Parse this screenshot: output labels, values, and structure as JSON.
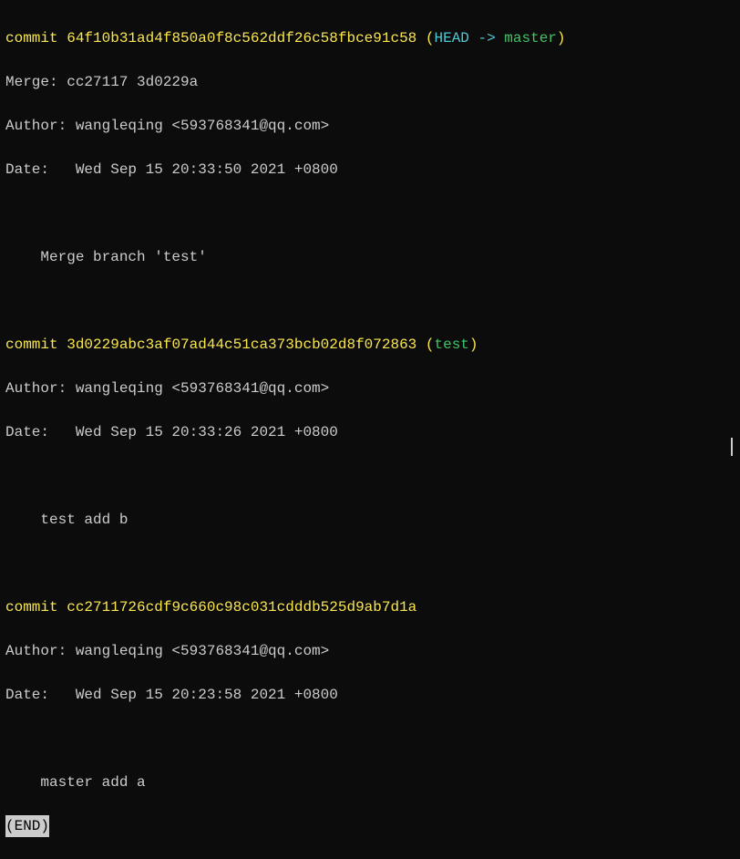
{
  "commits": [
    {
      "commit_label": "commit ",
      "hash": "64f10b31ad4f850a0f8c562ddf26c58fbce91c58",
      "ref_open": " (",
      "ref_head": "HEAD -> ",
      "ref_branch": "master",
      "ref_close": ")",
      "merge_line": "Merge: cc27117 3d0229a",
      "author_line": "Author: wangleqing <593768341@qq.com>",
      "date_line": "Date:   Wed Sep 15 20:33:50 2021 +0800",
      "message": "    Merge branch 'test'"
    },
    {
      "commit_label": "commit ",
      "hash": "3d0229abc3af07ad44c51ca373bcb02d8f072863",
      "ref_open": " (",
      "ref_branch": "test",
      "ref_close": ")",
      "author_line": "Author: wangleqing <593768341@qq.com>",
      "date_line": "Date:   Wed Sep 15 20:33:26 2021 +0800",
      "message": "    test add b"
    },
    {
      "commit_label": "commit ",
      "hash": "cc2711726cdf9c660c98c031cdddb525d9ab7d1a",
      "author_line": "Author: wangleqing <593768341@qq.com>",
      "date_line": "Date:   Wed Sep 15 20:23:58 2021 +0800",
      "message": "    master add a"
    }
  ],
  "end_marker": "(END)"
}
